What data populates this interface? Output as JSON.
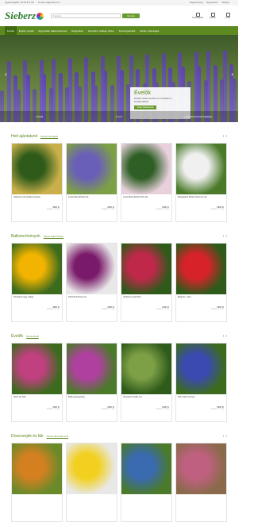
{
  "topbar": {
    "phone": "Ügyfélszolgálat: +36 96 511 700",
    "email": "E-mail: info@sieberz.hu",
    "country": "Magyarország",
    "register": "Regisztráció",
    "login": "Belépés"
  },
  "header": {
    "logo": "Sieberz",
    "search_placeholder": "Keresés...",
    "search_btn": "Keresés",
    "icons": [
      "Kívánságlista",
      "Fiókom",
      "Kosár"
    ]
  },
  "nav": [
    "Kezdet",
    "Évelők, cserjék",
    "Egynyáriak, balkonnövények",
    "Hagymások",
    "Gyümölcs, zöldség, fűszer",
    "Kerti kiegészítők",
    "Akciók, újdonságok"
  ],
  "hero": {
    "title": "Évelők",
    "text": "Évelők minden kertben és formában a kínálatunkban!",
    "cta": "Évelő felfedezése",
    "tabs": [
      "Évelők",
      "Évelők",
      "Leginkább kedvelt katalógus"
    ]
  },
  "sections": [
    {
      "title": "Heti ajánlatunk",
      "link": "Összes heti ajánlat",
      "products": [
        {
          "name": "Sophora microphylla Sunking",
          "price": "4990 Ft",
          "ship": "Szállítás: 1-2 hét",
          "colors": [
            "#2e5a1a",
            "#c9b04a"
          ]
        },
        {
          "name": "Levendula Hidcote (3)",
          "price": "2990 Ft",
          "ship": "Szállítás: 1-2 hét",
          "colors": [
            "#6a5fb8",
            "#7da046"
          ]
        },
        {
          "name": "Levendula Hidcote Pink (3)",
          "price": "2990 Ft",
          "ship": "Szállítás: 1-2 hét",
          "colors": [
            "#2f5f25",
            "#e8d0dc"
          ]
        },
        {
          "name": "Margarétas Wheel Supreme (3)",
          "price": "2990 Ft",
          "ship": "Szállítás: 1-2 hét",
          "colors": [
            "#f0f0f0",
            "#4a7a2a"
          ]
        }
      ]
    },
    {
      "title": "Balkonnövények",
      "link": "Összes balkonnövény",
      "products": [
        {
          "name": "Portulaca nagy virágú",
          "price": "4990 Ft",
          "ship": "Szállítás: 1-2 hét",
          "colors": [
            "#f2b400",
            "#3d6b1e"
          ]
        },
        {
          "name": "Petúnia Surfinia mix",
          "price": "2990 Ft",
          "ship": "Szállítás: 1-2 hét",
          "colors": [
            "#7a1a6a",
            "#e8e8e8"
          ]
        },
        {
          "name": "Verbéna Lanai Red",
          "price": "2490 Ft",
          "ship": "Szállítás: 1-2 hét",
          "colors": [
            "#c0284a",
            "#2e5a1a"
          ]
        },
        {
          "name": "Begónia · Duo",
          "price": "2990 Ft",
          "ship": "Szállítás: 1-2 hét",
          "colors": [
            "#d8222a",
            "#2e5a1a"
          ]
        }
      ]
    },
    {
      "title": "Évelők",
      "link": "Összes Évelő",
      "products": [
        {
          "name": "Iberis (2) 4db",
          "price": "2990 Ft",
          "ship": "Szállítás: 1-2 hét",
          "colors": [
            "#c04080",
            "#3d6b1e"
          ]
        },
        {
          "name": "Bükk gyöngyvirág",
          "price": "2990 Ft",
          "ship": "Szállítás: 1-2 hét",
          "colors": [
            "#b040a0",
            "#4a7a2a"
          ]
        },
        {
          "name": "Árnyékos évelők mix",
          "price": "2990 Ft",
          "ship": "Szállítás: 1-2 hét",
          "colors": [
            "#7da046",
            "#2e5a1a"
          ]
        },
        {
          "name": "Kék évelő csomag",
          "price": "2990 Ft",
          "ship": "Szállítás: 1-2 hét",
          "colors": [
            "#3a4ab0",
            "#3d6b1e"
          ]
        }
      ]
    },
    {
      "title": "Díszcserjék és fák",
      "link": "Összes díszcserje és fa",
      "products": [
        {
          "name": "",
          "price": "",
          "ship": "",
          "colors": [
            "#d48020",
            "#6a8a2a"
          ]
        },
        {
          "name": "",
          "price": "",
          "ship": "",
          "colors": [
            "#f2d020",
            "#e8e8e8"
          ]
        },
        {
          "name": "",
          "price": "",
          "ship": "",
          "colors": [
            "#3a6ab0",
            "#4a7a2a"
          ]
        },
        {
          "name": "",
          "price": "",
          "ship": "",
          "colors": [
            "#c06080",
            "#8a6a4a"
          ]
        }
      ]
    }
  ]
}
